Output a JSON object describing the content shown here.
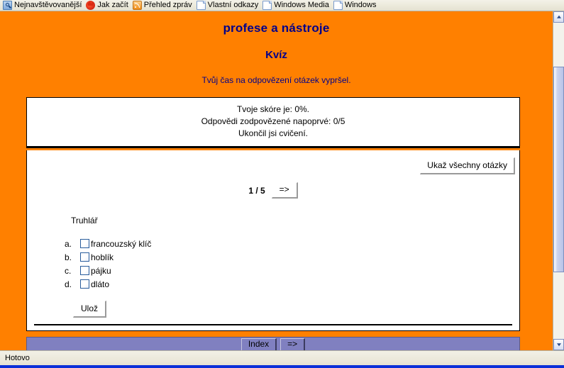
{
  "browser": {
    "bookmarks": [
      {
        "icon": "smart-folder-icon",
        "label": "Nejnavštěvovanější"
      },
      {
        "icon": "firefox-icon",
        "label": "Jak začít"
      },
      {
        "icon": "rss-feed-icon",
        "label": "Přehled zpráv"
      },
      {
        "icon": "page-icon",
        "label": "Vlastní odkazy"
      },
      {
        "icon": "page-icon",
        "label": "Windows Media"
      },
      {
        "icon": "page-icon",
        "label": "Windows"
      }
    ],
    "status_text": "Hotovo"
  },
  "page": {
    "site_title": "profese a nástroje",
    "quiz_title": "Kvíz",
    "timeout_message": "Tvůj čas na odpovězení otázek vypršel.",
    "colors": {
      "background": "#ff8000",
      "heading": "#00008b",
      "footer_bar": "#8080c0",
      "content": "#ffffff"
    }
  },
  "score_box": {
    "score_line": "Tvoje skóre je: 0%.",
    "first_try_line": "Odpovědi zodpovězené napoprvé: 0/5",
    "finished_line": "Ukončil jsi cvičení."
  },
  "quiz": {
    "show_all_label": "Ukaž všechny otázky",
    "counter": "1 / 5",
    "next_label": "=>",
    "question": "Truhlář",
    "options": [
      {
        "letter": "a.",
        "label": "francouzský klíč",
        "checked": false
      },
      {
        "letter": "b.",
        "label": "hoblík",
        "checked": false
      },
      {
        "letter": "c.",
        "label": "pájku",
        "checked": false
      },
      {
        "letter": "d.",
        "label": "dláto",
        "checked": false
      }
    ],
    "save_label": "Ulož"
  },
  "footer": {
    "index_label": "Index",
    "next_label": "=>"
  }
}
